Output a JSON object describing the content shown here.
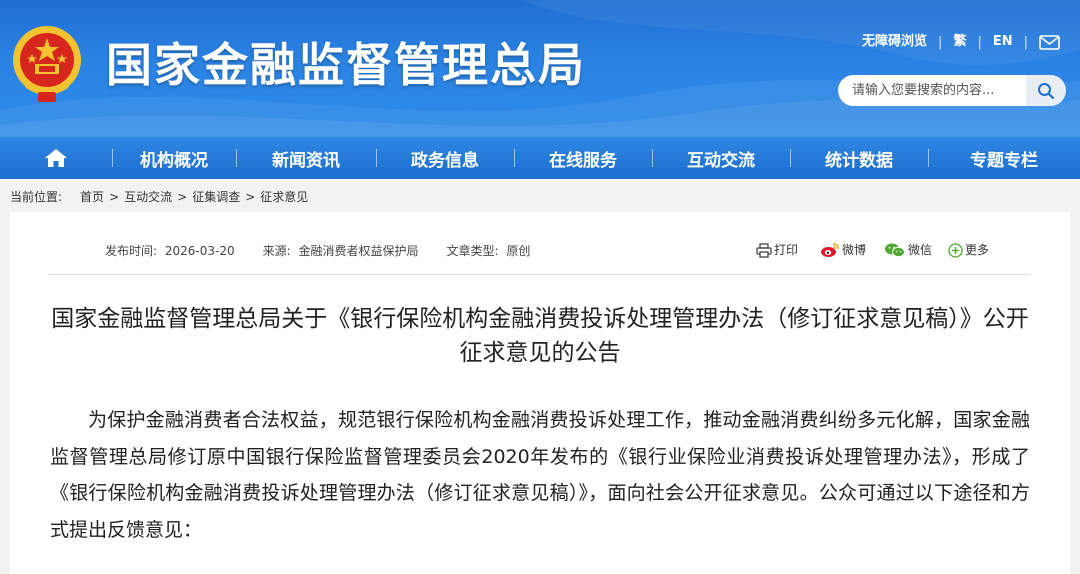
{
  "header": {
    "site_title": "国家金融监督管理总局",
    "top_links": [
      "无障碍浏览",
      "繁",
      "EN"
    ],
    "search_placeholder": "请输入您要搜索的内容..."
  },
  "nav": {
    "items": [
      "机构概况",
      "新闻资讯",
      "政务信息",
      "在线服务",
      "互动交流",
      "统计数据",
      "专题专栏"
    ]
  },
  "breadcrumb": {
    "label": "当前位置:",
    "items": [
      "首页",
      "互动交流",
      "征集调查",
      "征求意见"
    ]
  },
  "meta": {
    "publish_label": "发布时间:",
    "publish_date": "2026-03-20",
    "source_label": "来源:",
    "source": "金融消费者权益保护局",
    "type_label": "文章类型:",
    "type": "原创"
  },
  "share": {
    "print": "打印",
    "weibo": "微博",
    "wechat": "微信",
    "more": "更多"
  },
  "article": {
    "title": "国家金融监督管理总局关于《银行保险机构金融消费投诉处理管理办法（修订征求意见稿）》公开征求意见的公告",
    "paragraph": "为保护金融消费者合法权益，规范银行保险机构金融消费投诉处理工作，推动金融消费纠纷多元化解，国家金融监督管理总局修订原中国银行保险监督管理委员会2020年发布的《银行业保险业消费投诉处理管理办法》，形成了《银行保险机构金融消费投诉处理管理办法（修订征求意见稿）》，面向社会公开征求意见。公众可通过以下途径和方式提出反馈意见："
  },
  "colors": {
    "header_blue": "#2b83e3",
    "nav_blue": "#1d6fce",
    "emblem_red": "#d7261c",
    "emblem_gold": "#f4c430"
  },
  "icons": [
    "home-icon",
    "search-icon",
    "mail-icon",
    "print-icon",
    "weibo-icon",
    "wechat-icon",
    "plus-circle-icon"
  ]
}
